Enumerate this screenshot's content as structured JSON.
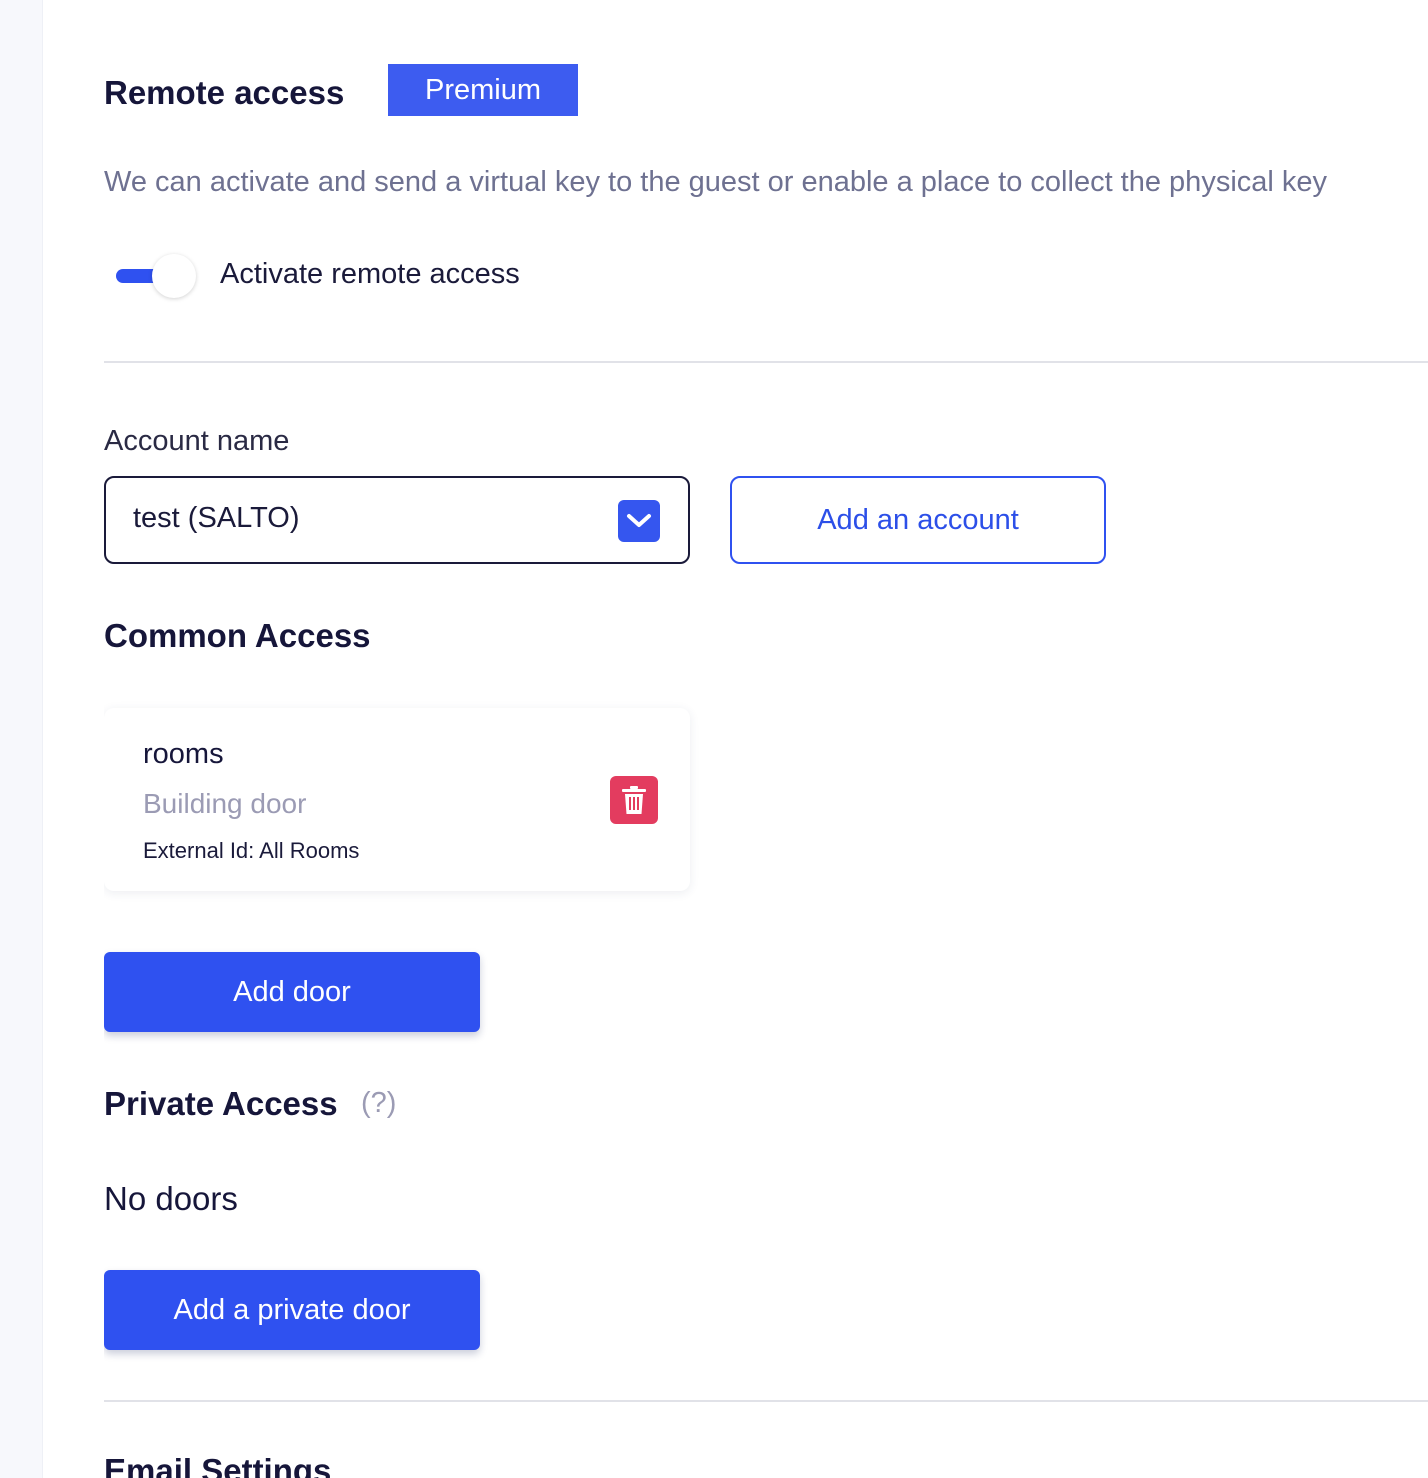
{
  "remote_access": {
    "title": "Remote access",
    "badge": "Premium",
    "description": "We can activate and send a virtual key to the guest or enable a place to collect the physical key",
    "toggle_label": "Activate remote access",
    "toggle_on": true
  },
  "account": {
    "label": "Account name",
    "selected": "test (SALTO)",
    "add_button": "Add an account"
  },
  "common_access": {
    "title": "Common Access",
    "doors": [
      {
        "name": "rooms",
        "type": "Building door",
        "external_id": "External Id: All Rooms"
      }
    ],
    "add_button": "Add door"
  },
  "private_access": {
    "title": "Private Access",
    "help": "(?)",
    "empty_text": "No doors",
    "add_button": "Add a private door"
  },
  "email_settings": {
    "title": "Email Settings"
  },
  "colors": {
    "primary": "#2f51f0",
    "badge": "#3d5cf0",
    "danger": "#e33c5f",
    "muted_text": "#6e7191",
    "heading": "#16163a"
  },
  "icons": {
    "dropdown": "chevron-down-icon",
    "delete": "trash-icon"
  }
}
